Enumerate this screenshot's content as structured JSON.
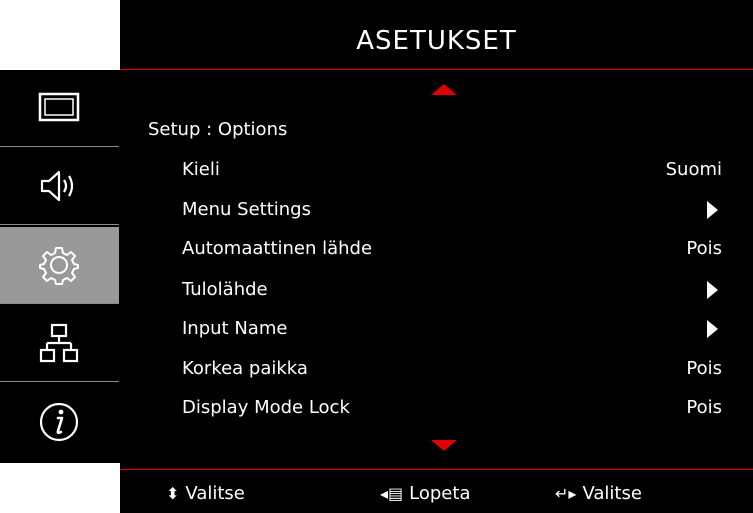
{
  "header": {
    "title": "ASETUKSET"
  },
  "sidebar": {
    "tabs": [
      {
        "icon": "display-icon",
        "active": false
      },
      {
        "icon": "speaker-icon",
        "active": false
      },
      {
        "icon": "gear-icon",
        "active": true
      },
      {
        "icon": "network-icon",
        "active": false
      },
      {
        "icon": "info-icon",
        "active": false
      }
    ]
  },
  "main": {
    "breadcrumb": "Setup : Options",
    "items": [
      {
        "label": "Kieli",
        "value": "Suomi"
      },
      {
        "label": "Menu Settings",
        "value": ""
      },
      {
        "label": "Automaattinen lähde",
        "value": "Pois"
      },
      {
        "label": "Tulolähde",
        "value": ""
      },
      {
        "label": "Input Name",
        "value": ""
      },
      {
        "label": "Korkea paikka",
        "value": "Pois"
      },
      {
        "label": "Display Mode Lock",
        "value": "Pois"
      }
    ]
  },
  "footer": {
    "select_label": "Valitse",
    "exit_label": "Lopeta",
    "enter_label": "Valitse"
  },
  "colors": {
    "accent": "#e10000",
    "active_tab": "#999999",
    "background": "#000000"
  }
}
